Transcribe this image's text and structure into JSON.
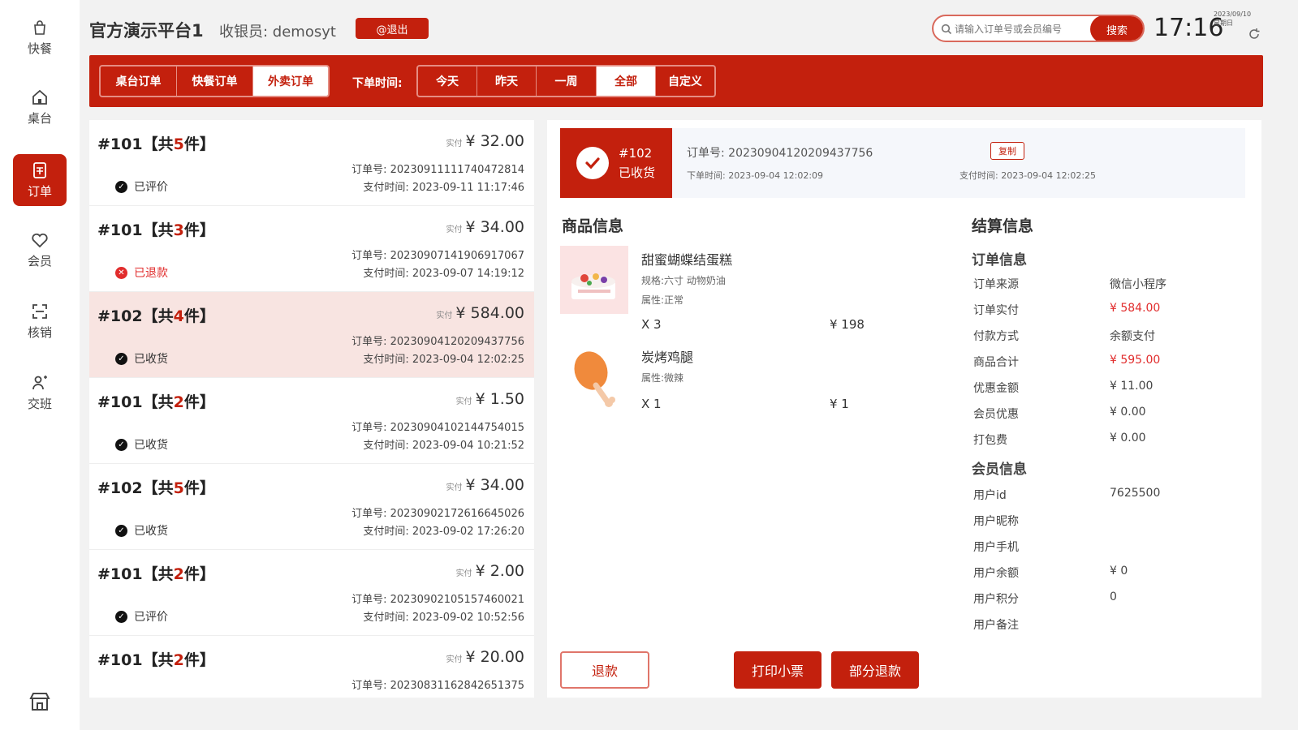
{
  "nav": {
    "items": [
      {
        "label": "快餐",
        "icon": "bag-icon"
      },
      {
        "label": "桌台",
        "icon": "home-icon"
      },
      {
        "label": "订单",
        "icon": "order-icon",
        "active": true
      },
      {
        "label": "会员",
        "icon": "heart-icon"
      },
      {
        "label": "核销",
        "icon": "scan-icon"
      },
      {
        "label": "交班",
        "icon": "handover-icon"
      }
    ],
    "bottom_icon": "store-icon"
  },
  "header": {
    "store_title": "官方演示平台1",
    "cashier_label": "收银员: demosyt",
    "logout_label": "@退出",
    "search_placeholder": "请输入订单号或会员编号",
    "search_button": "搜索",
    "clock": "17:16",
    "date": "2023/09/10",
    "weekday": "星期日"
  },
  "filter": {
    "order_tabs": [
      {
        "label": "桌台订单",
        "active": false
      },
      {
        "label": "快餐订单",
        "active": false
      },
      {
        "label": "外卖订单",
        "active": true
      }
    ],
    "time_label": "下单时间:",
    "time_tabs": [
      {
        "label": "今天",
        "active": false
      },
      {
        "label": "昨天",
        "active": false
      },
      {
        "label": "一周",
        "active": false
      },
      {
        "label": "全部",
        "active": true
      },
      {
        "label": "自定义",
        "active": false
      }
    ]
  },
  "orders": [
    {
      "title": "#101【共",
      "count": "5",
      "suffix": "件】",
      "tag": "实付",
      "amount": "¥ 32.00",
      "order_no": "订单号: 20230911111740472814",
      "pay_time": "支付时间: 2023-09-11 11:17:46",
      "status": "已评价",
      "refund": false,
      "selected": false
    },
    {
      "title": "#101【共",
      "count": "3",
      "suffix": "件】",
      "tag": "实付",
      "amount": "¥ 34.00",
      "order_no": "订单号: 20230907141906917067",
      "pay_time": "支付时间: 2023-09-07 14:19:12",
      "status": "已退款",
      "refund": true,
      "selected": false
    },
    {
      "title": "#102【共",
      "count": "4",
      "suffix": "件】",
      "tag": "实付",
      "amount": "¥ 584.00",
      "order_no": "订单号: 20230904120209437756",
      "pay_time": "支付时间: 2023-09-04 12:02:25",
      "status": "已收货",
      "refund": false,
      "selected": true
    },
    {
      "title": "#101【共",
      "count": "2",
      "suffix": "件】",
      "tag": "实付",
      "amount": "¥ 1.50",
      "order_no": "订单号: 20230904102144754015",
      "pay_time": "支付时间: 2023-09-04 10:21:52",
      "status": "已收货",
      "refund": false,
      "selected": false
    },
    {
      "title": "#102【共",
      "count": "5",
      "suffix": "件】",
      "tag": "实付",
      "amount": "¥ 34.00",
      "order_no": "订单号: 20230902172616645026",
      "pay_time": "支付时间: 2023-09-02 17:26:20",
      "status": "已收货",
      "refund": false,
      "selected": false
    },
    {
      "title": "#101【共",
      "count": "2",
      "suffix": "件】",
      "tag": "实付",
      "amount": "¥ 2.00",
      "order_no": "订单号: 20230902105157460021",
      "pay_time": "支付时间: 2023-09-02 10:52:56",
      "status": "已评价",
      "refund": false,
      "selected": false
    },
    {
      "title": "#101【共",
      "count": "2",
      "suffix": "件】",
      "tag": "实付",
      "amount": "¥ 20.00",
      "order_no": "订单号: 20230831162842651375",
      "pay_time": "",
      "status": "",
      "refund": false,
      "selected": false
    }
  ],
  "detail": {
    "badge_no": "#102",
    "badge_status": "已收货",
    "order_no": "订单号: 20230904120209437756",
    "order_time": "下单时间: 2023-09-04 12:02:09",
    "copy_label": "复制",
    "pay_time": "支付时间: 2023-09-04 12:02:25",
    "products_title": "商品信息",
    "products": [
      {
        "name": "甜蜜蝴蝶结蛋糕",
        "spec": "规格:六寸 动物奶油",
        "attr": "属性:正常",
        "qty": "X 3",
        "price": "¥ 198"
      },
      {
        "name": "炭烤鸡腿",
        "spec": "",
        "attr": "属性:微辣",
        "qty": "X 1",
        "price": "¥ 1"
      }
    ],
    "settle_title": "结算信息",
    "order_info_title": "订单信息",
    "order_info": [
      {
        "k": "订单来源",
        "v": "微信小程序",
        "red": false
      },
      {
        "k": "订单实付",
        "v": "¥ 584.00",
        "red": true
      },
      {
        "k": "付款方式",
        "v": "余额支付",
        "red": false
      },
      {
        "k": "商品合计",
        "v": "¥ 595.00",
        "red": true
      },
      {
        "k": "优惠金额",
        "v": "¥ 11.00",
        "red": false
      },
      {
        "k": "会员优惠",
        "v": "¥ 0.00",
        "red": false
      },
      {
        "k": "打包费",
        "v": "¥ 0.00",
        "red": false
      }
    ],
    "member_info_title": "会员信息",
    "member_info": [
      {
        "k": "用户id",
        "v": "7625500"
      },
      {
        "k": "用户昵称",
        "v": ""
      },
      {
        "k": "用户手机",
        "v": ""
      },
      {
        "k": "用户余额",
        "v": "¥ 0"
      },
      {
        "k": "用户积分",
        "v": "0"
      },
      {
        "k": "用户备注",
        "v": ""
      }
    ],
    "buttons": {
      "refund": "退款",
      "print": "打印小票",
      "partial_refund": "部分退款"
    }
  },
  "colors": {
    "accent": "#c3200d",
    "refund": "#e12c2c"
  }
}
